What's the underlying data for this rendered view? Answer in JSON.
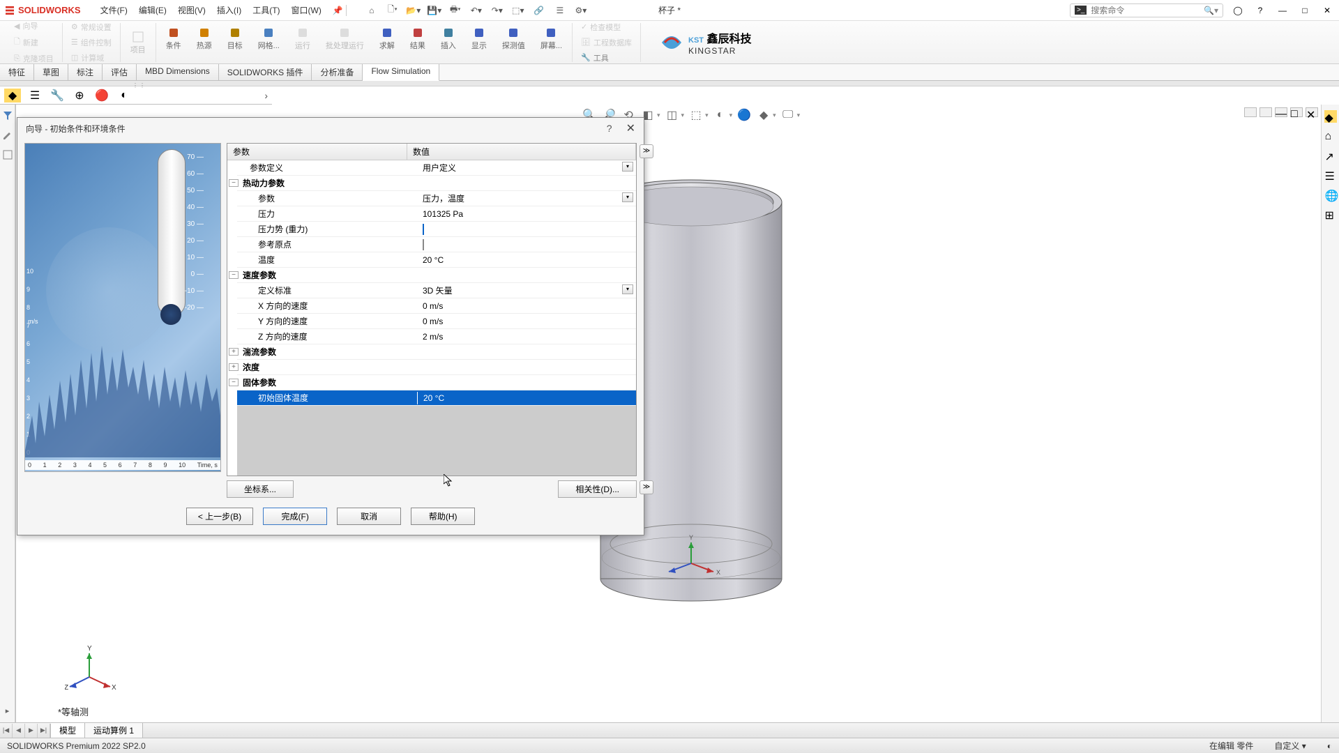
{
  "app": {
    "name": "SOLIDWORKS",
    "doc_name": "杯子 *"
  },
  "menus": [
    "文件(F)",
    "编辑(E)",
    "视图(V)",
    "插入(I)",
    "工具(T)",
    "窗口(W)"
  ],
  "search_placeholder": "搜索命令",
  "ribbon": {
    "side": {
      "wizard": "向导",
      "new": "新建",
      "clone": "克隆项目",
      "general": "常规设置",
      "component": "组件控制",
      "calc": "计算域",
      "project": "项目"
    },
    "main": [
      {
        "label": "条件",
        "icon": "#c05020"
      },
      {
        "label": "热源",
        "icon": "#d08000"
      },
      {
        "label": "目标",
        "icon": "#b08000"
      },
      {
        "label": "网格...",
        "icon": "#4a80c0"
      },
      {
        "label": "运行",
        "icon": "#60a060",
        "dis": true
      },
      {
        "label": "批处理运行",
        "icon": "#888",
        "dis": true
      },
      {
        "label": "求解",
        "icon": "#4060c0"
      },
      {
        "label": "结果",
        "icon": "#c04040"
      },
      {
        "label": "插入",
        "icon": "#4080a0"
      },
      {
        "label": "显示",
        "icon": "#4060c0"
      },
      {
        "label": "探测值",
        "icon": "#4060c0"
      },
      {
        "label": "屏幕...",
        "icon": "#4060c0"
      }
    ],
    "extra": {
      "check": "检查模型",
      "db": "工程数据库",
      "tools": "工具"
    }
  },
  "company": {
    "cn": "鑫辰科技",
    "en": "KINGSTAR",
    "tag": "KST"
  },
  "tabs": [
    "特征",
    "草图",
    "标注",
    "评估",
    "MBD Dimensions",
    "SOLIDWORKS 插件",
    "分析准备",
    "Flow Simulation"
  ],
  "active_tab": 7,
  "dialog": {
    "title": "向导 - 初始条件和环境条件",
    "col_param": "参数",
    "col_value": "数值",
    "rows": {
      "param_def_lbl": "参数定义",
      "param_def_val": "用户定义",
      "thermo_lbl": "热动力参数",
      "thermo_param_lbl": "参数",
      "thermo_param_val": "压力，温度",
      "pressure_lbl": "压力",
      "pressure_val": "101325 Pa",
      "gravity_lbl": "压力势 (重力)",
      "refpt_lbl": "参考原点",
      "temp_lbl": "温度",
      "temp_val": "20 °C",
      "velocity_lbl": "速度参数",
      "def_std_lbl": "定义标准",
      "def_std_val": "3D 矢量",
      "vx_lbl": "X 方向的速度",
      "vx_val": "0 m/s",
      "vy_lbl": "Y 方向的速度",
      "vy_val": "0 m/s",
      "vz_lbl": "Z 方向的速度",
      "vz_val": "2 m/s",
      "turb_lbl": "湍流参数",
      "conc_lbl": "浓度",
      "solid_lbl": "固体参数",
      "solid_temp_lbl": "初始固体温度",
      "solid_temp_val": "20 °C"
    },
    "coord_btn": "坐标系...",
    "rel_btn": "相关性(D)...",
    "back": "< 上一步(B)",
    "finish": "完成(F)",
    "cancel": "取消",
    "help": "帮助(H)"
  },
  "preview": {
    "y_ticks": [
      "70",
      "60",
      "50",
      "40",
      "30",
      "20",
      "10",
      "0",
      "-10",
      "-20"
    ],
    "y_label": "m/s",
    "y2": [
      "10",
      "9",
      "8",
      "7",
      "6",
      "5",
      "4",
      "3",
      "2",
      "1",
      "0"
    ],
    "x_label": "Time, s",
    "x_ticks": [
      "0",
      "1",
      "2",
      "3",
      "4",
      "5",
      "6",
      "7",
      "8",
      "9",
      "10"
    ]
  },
  "view_label": "*等轴测",
  "bottom_tabs": [
    "模型",
    "运动算例 1"
  ],
  "status": {
    "version": "SOLIDWORKS Premium 2022 SP2.0",
    "mode": "在编辑 零件",
    "custom": "自定义"
  }
}
